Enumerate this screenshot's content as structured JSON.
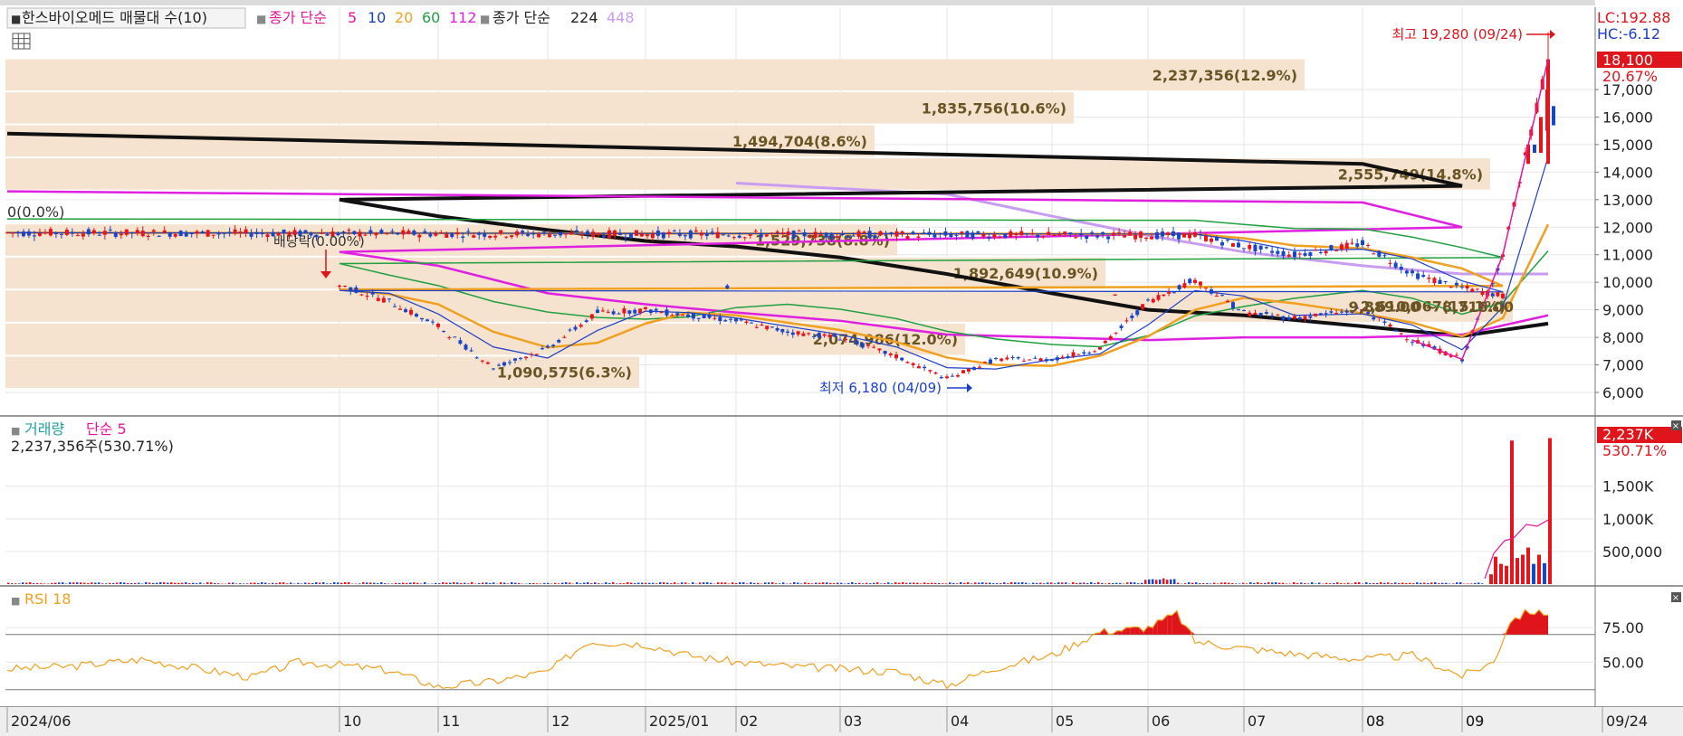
{
  "legend": {
    "stock": "한스바이오메드 매물대 수(10)",
    "ma_prefix": "종가 단순",
    "ma_5": "5",
    "ma_10": "10",
    "ma_20": "20",
    "ma_60": "60",
    "ma_112": "112",
    "ma2_prefix": "종가 단순",
    "ma_224": "224",
    "ma_448": "448"
  },
  "colors": {
    "up": "#e8141b",
    "down": "#1846c8",
    "ma5": "#e8149b",
    "ma10": "#1b3fc8",
    "ma20": "#f0a020",
    "ma60": "#20a040",
    "ma112": "#e020e0",
    "ma224": "#111111",
    "ma448": "#c89cf0",
    "volume_band": "#f5e3cf",
    "rsi": "#f0a020"
  },
  "price_panel": {
    "lc": "LC:192.88",
    "hc": "HC:-6.12",
    "current_price": "18,100",
    "current_change": "20.67%",
    "high_label": "최고 19,280 (09/24)",
    "low_label": "최저 6,180 (04/09)",
    "dividend_label": "배당락(0.00%)",
    "start_label": "0(0.0%)",
    "range_label": "9,889.00 ~ 8,716.00"
  },
  "volume_panel": {
    "title": "거래량",
    "ma_label": "단순 5",
    "value_text": "2,237,356주(530.71%)",
    "current_badge": "2,237K",
    "current_pct": "530.71%"
  },
  "rsi_panel": {
    "title": "RSI 18"
  },
  "chart_data": [
    {
      "type": "volume_profile_candlestick",
      "title": "한스바이오메드 매물대 수(10)",
      "y_ticks": [
        "17,000",
        "16,000",
        "15,000",
        "14,000",
        "13,000",
        "12,000",
        "11,000",
        "10,000",
        "9,000",
        "8,000",
        "7,000",
        "6,000"
      ],
      "ylim": [
        5400,
        20300
      ],
      "x_ticks": [
        "2024/06",
        "08",
        "09",
        "10",
        "11",
        "12",
        "2025/01",
        "02",
        "03",
        "04",
        "05",
        "06",
        "07",
        "08",
        "09",
        "09/24"
      ],
      "volume_profile": [
        {
          "price_low": 16900,
          "price_high": 18100,
          "volume_label": "2,237,356(12.9%)"
        },
        {
          "price_low": 15700,
          "price_high": 16900,
          "volume_label": "1,835,756(10.6%)"
        },
        {
          "price_low": 14500,
          "price_high": 15700,
          "volume_label": "1,494,704(8.6%)"
        },
        {
          "price_low": 13300,
          "price_high": 14500,
          "volume_label": "2,555,749(14.8%)"
        },
        {
          "price_low": 10900,
          "price_high": 12100,
          "volume_label": "1,529,738(8.8%)"
        },
        {
          "price_low": 9700,
          "price_high": 10900,
          "volume_label": "1,892,649(10.9%)"
        },
        {
          "price_low": 8500,
          "price_high": 9700,
          "volume_label": "2,610,067(15.1%)"
        },
        {
          "price_low": 7300,
          "price_high": 8500,
          "volume_label": "2,074,986(12.0%)"
        },
        {
          "price_low": 6100,
          "price_high": 7300,
          "volume_label": "1,090,575(6.3%)"
        }
      ],
      "close_path": [
        [
          "2024/06",
          11800
        ],
        [
          "06m",
          11700
        ],
        [
          "07",
          11300
        ],
        [
          "07m",
          11000
        ],
        [
          "08",
          11400
        ],
        [
          "08m",
          10300
        ],
        [
          "09",
          9800
        ],
        [
          "09m",
          9500
        ],
        [
          "10",
          9900
        ],
        [
          "10m",
          9300
        ],
        [
          "11",
          8400
        ],
        [
          "11m",
          6900
        ],
        [
          "12",
          7600
        ],
        [
          "12m",
          8900
        ],
        [
          "2025/01",
          9000
        ],
        [
          "01m",
          8800
        ],
        [
          "02",
          8600
        ],
        [
          "02m",
          8200
        ],
        [
          "03",
          8000
        ],
        [
          "03m",
          7300
        ],
        [
          "04",
          6500
        ],
        [
          "04m",
          7200
        ],
        [
          "05",
          7200
        ],
        [
          "05m",
          7600
        ],
        [
          "06",
          9300
        ],
        [
          "06m",
          10100
        ],
        [
          "07",
          8900
        ],
        [
          "07m",
          8700
        ],
        [
          "08",
          9000
        ],
        [
          "08m",
          7900
        ],
        [
          "09",
          7200
        ],
        [
          "09m",
          11000
        ],
        [
          "09/24",
          18100
        ]
      ],
      "ma224_path": [
        [
          "2024/06",
          15400
        ],
        [
          "08",
          14300
        ],
        [
          "09",
          13500
        ],
        [
          "10",
          13000
        ],
        [
          "11",
          12400
        ],
        [
          "12",
          11900
        ],
        [
          "2025/01",
          11500
        ],
        [
          "02",
          11300
        ],
        [
          "03",
          10900
        ],
        [
          "04",
          10300
        ],
        [
          "05",
          9600
        ],
        [
          "06",
          9000
        ],
        [
          "07",
          8800
        ],
        [
          "08",
          8400
        ],
        [
          "09",
          8050
        ],
        [
          "09/24",
          8500
        ]
      ],
      "ma448_path": [
        [
          "02",
          13600
        ],
        [
          "03",
          13400
        ],
        [
          "04",
          13200
        ],
        [
          "05",
          12400
        ],
        [
          "06",
          11700
        ],
        [
          "07",
          11100
        ],
        [
          "08",
          10600
        ],
        [
          "09",
          10300
        ],
        [
          "09/24",
          10300
        ]
      ],
      "ma112_path": [
        [
          "2024/06",
          13300
        ],
        [
          "08",
          12900
        ],
        [
          "09",
          12000
        ],
        [
          "10",
          11100
        ],
        [
          "11",
          10600
        ],
        [
          "12",
          9600
        ],
        [
          "2025/01",
          9200
        ],
        [
          "02",
          8900
        ],
        [
          "03",
          8600
        ],
        [
          "04",
          8100
        ],
        [
          "05",
          8000
        ],
        [
          "06",
          7900
        ],
        [
          "07",
          8000
        ],
        [
          "08",
          8000
        ],
        [
          "09",
          8100
        ],
        [
          "09/24",
          8800
        ]
      ]
    },
    {
      "type": "bar",
      "title": "거래량",
      "y_ticks": [
        "1,500K",
        "1,000K",
        "500,000"
      ],
      "ylim": [
        0,
        2300000
      ],
      "spikes": [
        {
          "x": "09m",
          "value": 2200000
        },
        {
          "x": "09/24",
          "value": 2237356
        }
      ]
    },
    {
      "type": "line",
      "title": "RSI 18",
      "y_ticks": [
        "75.00",
        "50.00"
      ],
      "ylim": [
        20,
        100
      ]
    }
  ]
}
